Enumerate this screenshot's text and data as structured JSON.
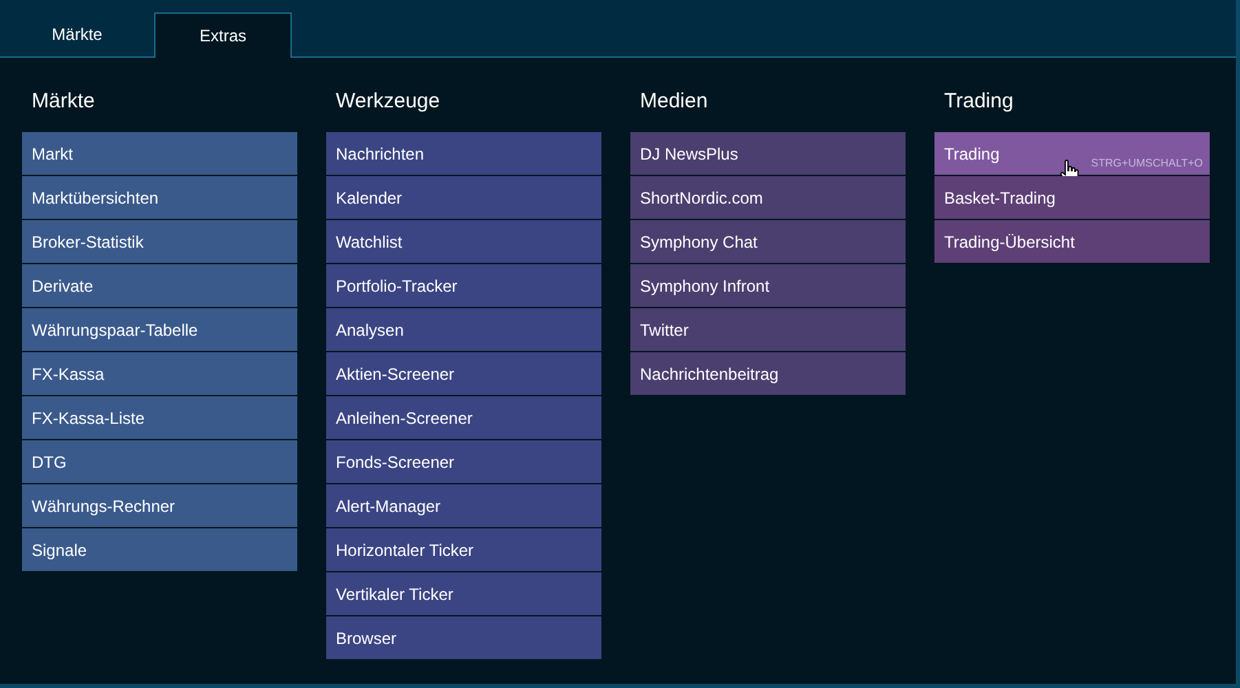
{
  "tabs": [
    {
      "label": "Märkte",
      "selected": false
    },
    {
      "label": "Extras",
      "selected": true
    }
  ],
  "columns": [
    {
      "title": "Märkte",
      "color": "#3a5a8c",
      "items": [
        {
          "label": "Markt",
          "hovered": false
        },
        {
          "label": "Marktübersichten",
          "hovered": false
        },
        {
          "label": "Broker-Statistik",
          "hovered": false
        },
        {
          "label": "Derivate",
          "hovered": false
        },
        {
          "label": "Währungspaar-Tabelle",
          "hovered": false
        },
        {
          "label": "FX-Kassa",
          "hovered": false
        },
        {
          "label": "FX-Kassa-Liste",
          "hovered": false
        },
        {
          "label": "DTG",
          "hovered": false
        },
        {
          "label": "Währungs-Rechner",
          "hovered": false
        },
        {
          "label": "Signale",
          "hovered": false
        }
      ]
    },
    {
      "title": "Werkzeuge",
      "color": "#3b4583",
      "items": [
        {
          "label": "Nachrichten",
          "hovered": false
        },
        {
          "label": "Kalender",
          "hovered": false
        },
        {
          "label": "Watchlist",
          "hovered": false
        },
        {
          "label": "Portfolio-Tracker",
          "hovered": false
        },
        {
          "label": "Analysen",
          "hovered": false
        },
        {
          "label": "Aktien-Screener",
          "hovered": false
        },
        {
          "label": "Anleihen-Screener",
          "hovered": false
        },
        {
          "label": "Fonds-Screener",
          "hovered": false
        },
        {
          "label": "Alert-Manager",
          "hovered": false
        },
        {
          "label": "Horizontaler Ticker",
          "hovered": false
        },
        {
          "label": "Vertikaler Ticker",
          "hovered": false
        },
        {
          "label": "Browser",
          "hovered": false
        }
      ]
    },
    {
      "title": "Medien",
      "color": "#4a3f6f",
      "items": [
        {
          "label": "DJ NewsPlus",
          "hovered": false
        },
        {
          "label": "ShortNordic.com",
          "hovered": false
        },
        {
          "label": "Symphony Chat",
          "hovered": false
        },
        {
          "label": "Symphony Infront",
          "hovered": false
        },
        {
          "label": "Twitter",
          "hovered": false
        },
        {
          "label": "Nachrichtenbeitrag",
          "hovered": false
        }
      ]
    },
    {
      "title": "Trading",
      "color": "#5e3f76",
      "items": [
        {
          "label": "Trading",
          "hovered": true,
          "shortcut": "STRG+UMSCHALT+O"
        },
        {
          "label": "Basket-Trading",
          "hovered": false
        },
        {
          "label": "Trading-Übersicht",
          "hovered": false
        }
      ]
    }
  ]
}
